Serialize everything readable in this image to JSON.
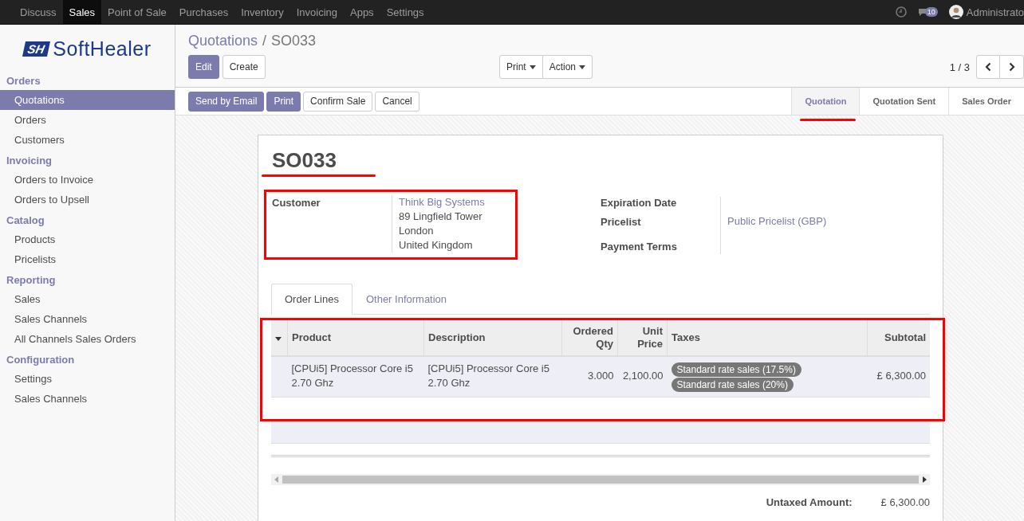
{
  "top_menu": [
    {
      "label": "Discuss",
      "selected": false
    },
    {
      "label": "Sales",
      "selected": true
    },
    {
      "label": "Point of Sale",
      "selected": false
    },
    {
      "label": "Purchases",
      "selected": false
    },
    {
      "label": "Inventory",
      "selected": false
    },
    {
      "label": "Invoicing",
      "selected": false
    },
    {
      "label": "Apps",
      "selected": false
    },
    {
      "label": "Settings",
      "selected": false
    }
  ],
  "systray": {
    "messages_count": "10",
    "user": "Administrato"
  },
  "logo": {
    "mark": "SH",
    "text": "SoftHealer"
  },
  "sidebar": [
    {
      "title": "Orders",
      "items": [
        {
          "label": "Quotations",
          "selected": true
        },
        {
          "label": "Orders",
          "selected": false
        },
        {
          "label": "Customers",
          "selected": false
        }
      ]
    },
    {
      "title": "Invoicing",
      "items": [
        {
          "label": "Orders to Invoice",
          "selected": false
        },
        {
          "label": "Orders to Upsell",
          "selected": false
        }
      ]
    },
    {
      "title": "Catalog",
      "items": [
        {
          "label": "Products",
          "selected": false
        },
        {
          "label": "Pricelists",
          "selected": false
        }
      ]
    },
    {
      "title": "Reporting",
      "items": [
        {
          "label": "Sales",
          "selected": false
        },
        {
          "label": "Sales Channels",
          "selected": false
        },
        {
          "label": "All Channels Sales Orders",
          "selected": false
        }
      ]
    },
    {
      "title": "Configuration",
      "items": [
        {
          "label": "Settings",
          "selected": false
        },
        {
          "label": "Sales Channels",
          "selected": false
        }
      ]
    }
  ],
  "breadcrumb": {
    "parent": "Quotations",
    "separator": "/",
    "current": "SO033"
  },
  "main_buttons": [
    {
      "label": "Edit",
      "kind": "primary"
    },
    {
      "label": "Create",
      "kind": "default"
    }
  ],
  "dropdowns": [
    "Print",
    "Action"
  ],
  "pager": "1 / 3",
  "header_buttons": [
    {
      "label": "Send by Email",
      "kind": "primary"
    },
    {
      "label": "Print",
      "kind": "primary"
    },
    {
      "label": "Confirm Sale",
      "kind": "default"
    },
    {
      "label": "Cancel",
      "kind": "default"
    }
  ],
  "stages": [
    {
      "label": "Quotation",
      "selected": true
    },
    {
      "label": "Quotation Sent",
      "selected": false
    },
    {
      "label": "Sales Order",
      "selected": false
    }
  ],
  "sheet": {
    "name": "SO033",
    "customer": {
      "label": "Customer",
      "name": "Think Big Systems",
      "address": [
        "89 Lingfield Tower",
        "London",
        "United Kingdom"
      ]
    },
    "right_fields": [
      {
        "label": "Expiration Date"
      },
      {
        "label": "Pricelist",
        "value": "Public Pricelist (GBP)"
      },
      {
        "label": "Payment Terms"
      }
    ],
    "tabs": [
      {
        "label": "Order Lines",
        "selected": true
      },
      {
        "label": "Other Information",
        "selected": false
      }
    ],
    "table": {
      "columns": [
        {
          "label": "Product"
        },
        {
          "label": "Description"
        },
        {
          "label": "Ordered Qty"
        },
        {
          "label": "Unit Price"
        },
        {
          "label": "Taxes"
        },
        {
          "label": "Subtotal"
        }
      ],
      "rows": [
        {
          "product": "[CPUi5] Processor Core i5 2.70 Ghz",
          "description": "[CPUi5] Processor Core i5 2.70 Ghz",
          "qty": "3.000",
          "unit_price": "2,100.00",
          "taxes": [
            "Standard rate sales (17.5%)",
            "Standard rate sales (20%)"
          ],
          "subtotal": "£ 6,300.00"
        }
      ]
    },
    "totals": [
      {
        "label": "Untaxed Amount:",
        "value": "£ 6,300.00"
      }
    ]
  }
}
